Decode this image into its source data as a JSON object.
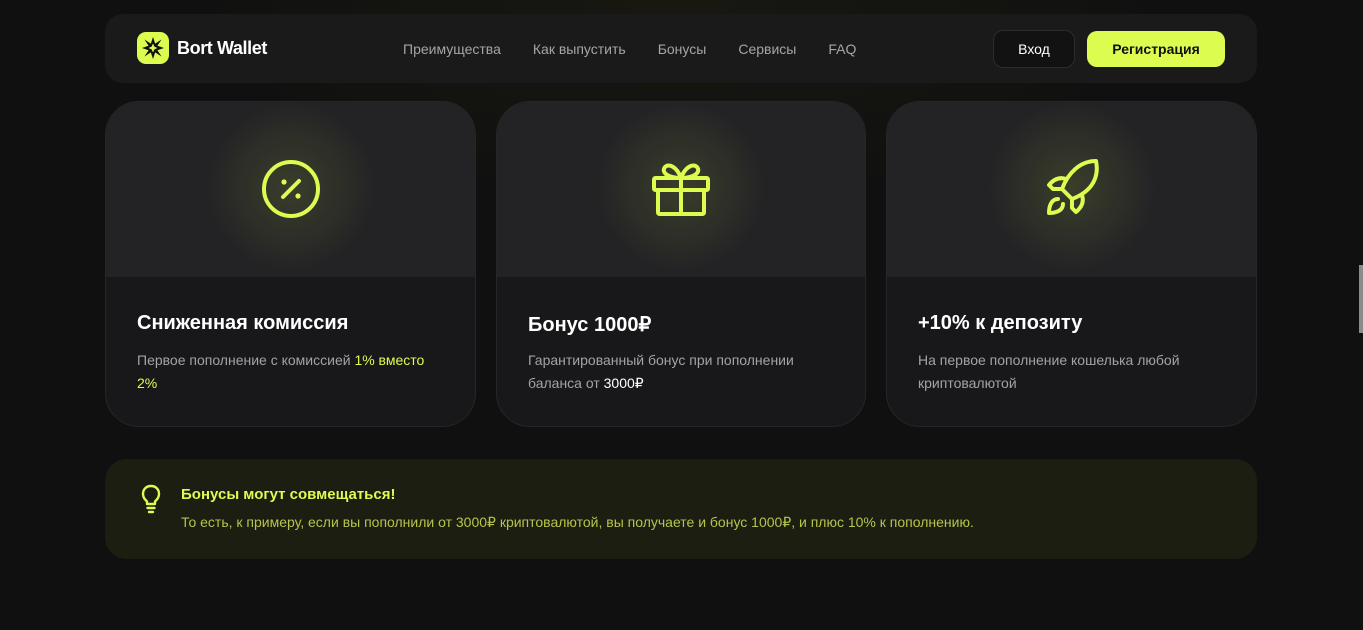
{
  "header": {
    "brand": "Bort Wallet",
    "nav": [
      "Преимущества",
      "Как выпустить",
      "Бонусы",
      "Сервисы",
      "FAQ"
    ],
    "login_label": "Вход",
    "register_label": "Регистрация"
  },
  "cards": [
    {
      "icon": "percent-icon",
      "title": "Сниженная комиссия",
      "desc_prefix": "Первое пополнение с комиссией ",
      "desc_highlight": "1% вместо 2%"
    },
    {
      "icon": "gift-icon",
      "title": "Бонус 1000₽",
      "desc_prefix": "Гарантированный бонус при пополнении баланса от ",
      "desc_highlight": "3000₽"
    },
    {
      "icon": "rocket-icon",
      "title": "+10% к депозиту",
      "desc_prefix": "На первое пополнение кошелька любой криптовалютой",
      "desc_highlight": ""
    }
  ],
  "banner": {
    "icon": "lightbulb-icon",
    "title": "Бонусы могут совмещаться!",
    "text": "То есть, к примеру, если вы пополнили от 3000₽ криптовалютой, вы получаете и бонус 1000₽, и плюс 10% к пополнению."
  },
  "colors": {
    "accent": "#dcfc50",
    "background": "#101010",
    "card": "#18181a"
  }
}
